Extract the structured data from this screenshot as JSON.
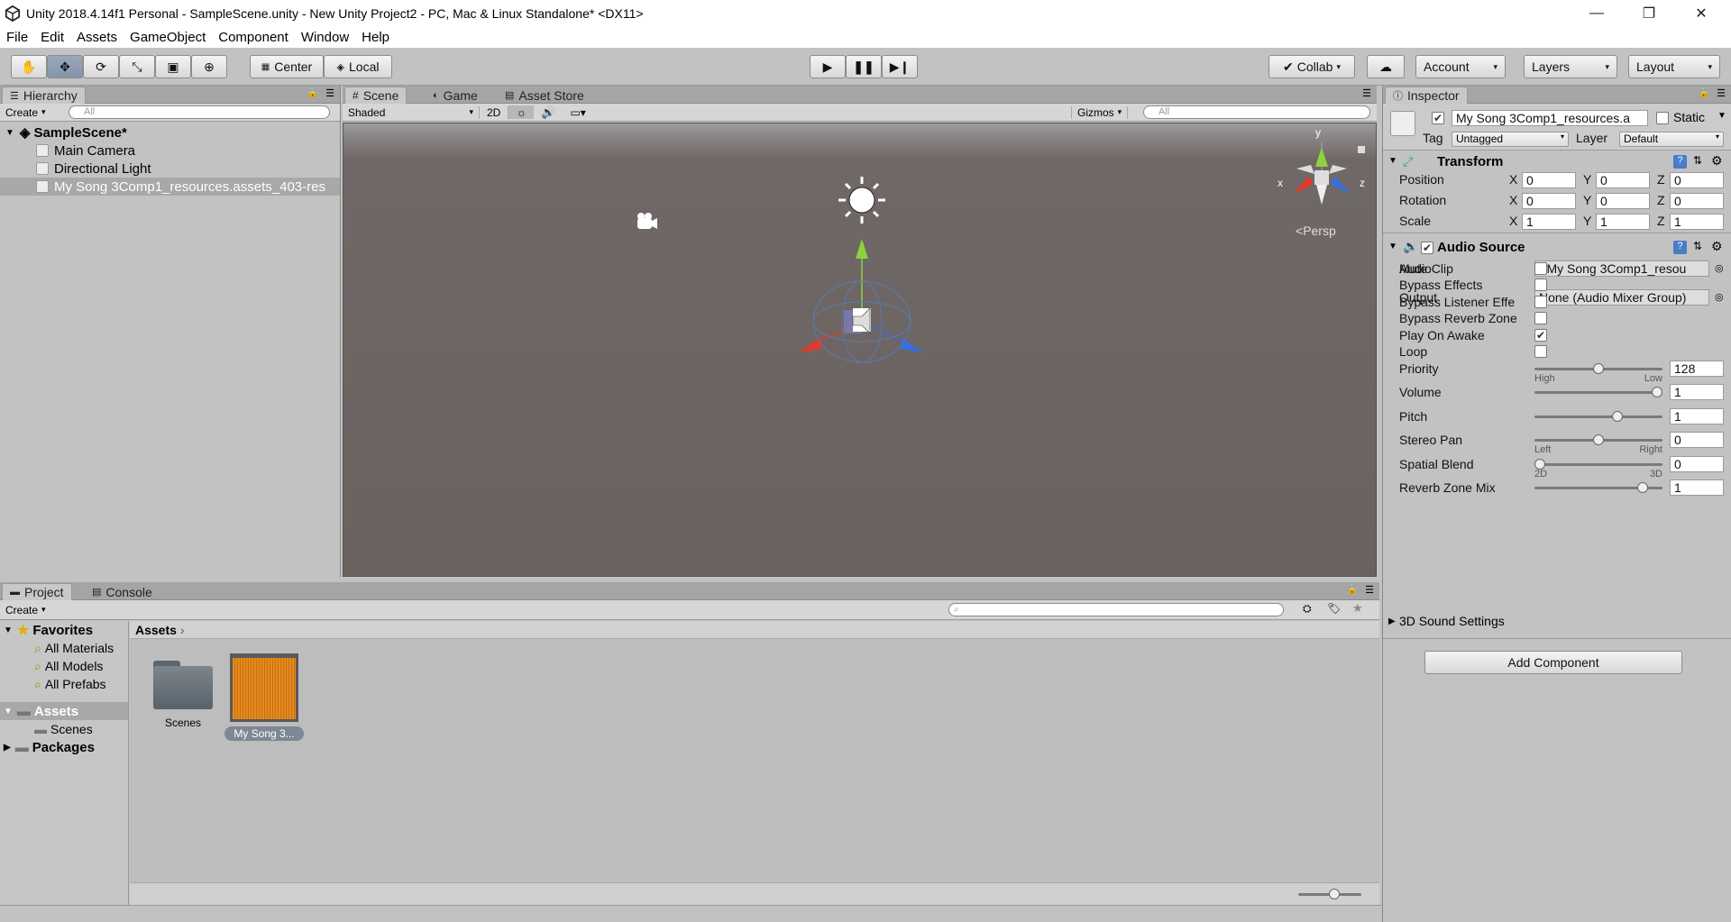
{
  "window": {
    "title": "Unity 2018.4.14f1 Personal - SampleScene.unity - New Unity Project2 - PC, Mac & Linux Standalone* <DX11>",
    "minimize": "—",
    "restore": "❐",
    "close": "✕"
  },
  "menu": [
    "File",
    "Edit",
    "Assets",
    "GameObject",
    "Component",
    "Window",
    "Help"
  ],
  "toolbar": {
    "pivot": "Center",
    "space": "Local",
    "collab": "Collab",
    "account": "Account",
    "layers": "Layers",
    "layout": "Layout"
  },
  "hierarchy": {
    "tab": "Hierarchy",
    "create": "Create",
    "search_placeholder": "All",
    "scene": "SampleScene*",
    "items": [
      "Main Camera",
      "Directional Light",
      "My Song 3Comp1_resources.assets_403-res"
    ]
  },
  "scene": {
    "tabs": [
      "Scene",
      "Game",
      "Asset Store"
    ],
    "shading": "Shaded",
    "mode2d": "2D",
    "gizmos": "Gizmos",
    "search_placeholder": "All",
    "persp": "Persp",
    "axis_x": "x",
    "axis_y": "y",
    "axis_z": "z"
  },
  "project": {
    "tabs": [
      "Project",
      "Console"
    ],
    "create": "Create",
    "favorites_label": "Favorites",
    "favorites": [
      "All Materials",
      "All Models",
      "All Prefabs"
    ],
    "assets_label": "Assets",
    "assets_children": [
      "Scenes"
    ],
    "packages_label": "Packages",
    "breadcrumb": "Assets",
    "files": [
      "Scenes",
      "My Song 3..."
    ]
  },
  "inspector": {
    "tab": "Inspector",
    "name": "My Song 3Comp1_resources.a",
    "static": "Static",
    "tag_label": "Tag",
    "tag": "Untagged",
    "layer_label": "Layer",
    "layer": "Default",
    "transform": {
      "title": "Transform",
      "position": {
        "label": "Position",
        "x": "0",
        "y": "0",
        "z": "0"
      },
      "rotation": {
        "label": "Rotation",
        "x": "0",
        "y": "0",
        "z": "0"
      },
      "scale": {
        "label": "Scale",
        "x": "1",
        "y": "1",
        "z": "1"
      }
    },
    "audio": {
      "title": "Audio Source",
      "audioclip_label": "AudioClip",
      "audioclip": "My Song 3Comp1_resou",
      "output_label": "Output",
      "output": "None (Audio Mixer Group)",
      "toggles": [
        {
          "label": "Mute",
          "checked": false
        },
        {
          "label": "Bypass Effects",
          "checked": false
        },
        {
          "label": "Bypass Listener Effe",
          "checked": false
        },
        {
          "label": "Bypass Reverb Zone",
          "checked": false
        },
        {
          "label": "Play On Awake",
          "checked": true
        },
        {
          "label": "Loop",
          "checked": false
        }
      ],
      "sliders": [
        {
          "label": "Priority",
          "value": "128",
          "fraction": 0.5,
          "min_label": "High",
          "max_label": "Low"
        },
        {
          "label": "Volume",
          "value": "1",
          "fraction": 1.0,
          "min_label": "",
          "max_label": ""
        },
        {
          "label": "Pitch",
          "value": "1",
          "fraction": 0.66,
          "min_label": "",
          "max_label": ""
        },
        {
          "label": "Stereo Pan",
          "value": "0",
          "fraction": 0.5,
          "min_label": "Left",
          "max_label": "Right"
        },
        {
          "label": "Spatial Blend",
          "value": "0",
          "fraction": 0.0,
          "min_label": "2D",
          "max_label": "3D"
        },
        {
          "label": "Reverb Zone Mix",
          "value": "1",
          "fraction": 0.88,
          "min_label": "",
          "max_label": ""
        }
      ],
      "sound3d": "3D Sound Settings"
    },
    "add_component": "Add Component"
  },
  "colors": {
    "scene_sky": "#8a8a8a",
    "scene_ground": "#6b625e",
    "audio_orange": "#e58a1f"
  }
}
